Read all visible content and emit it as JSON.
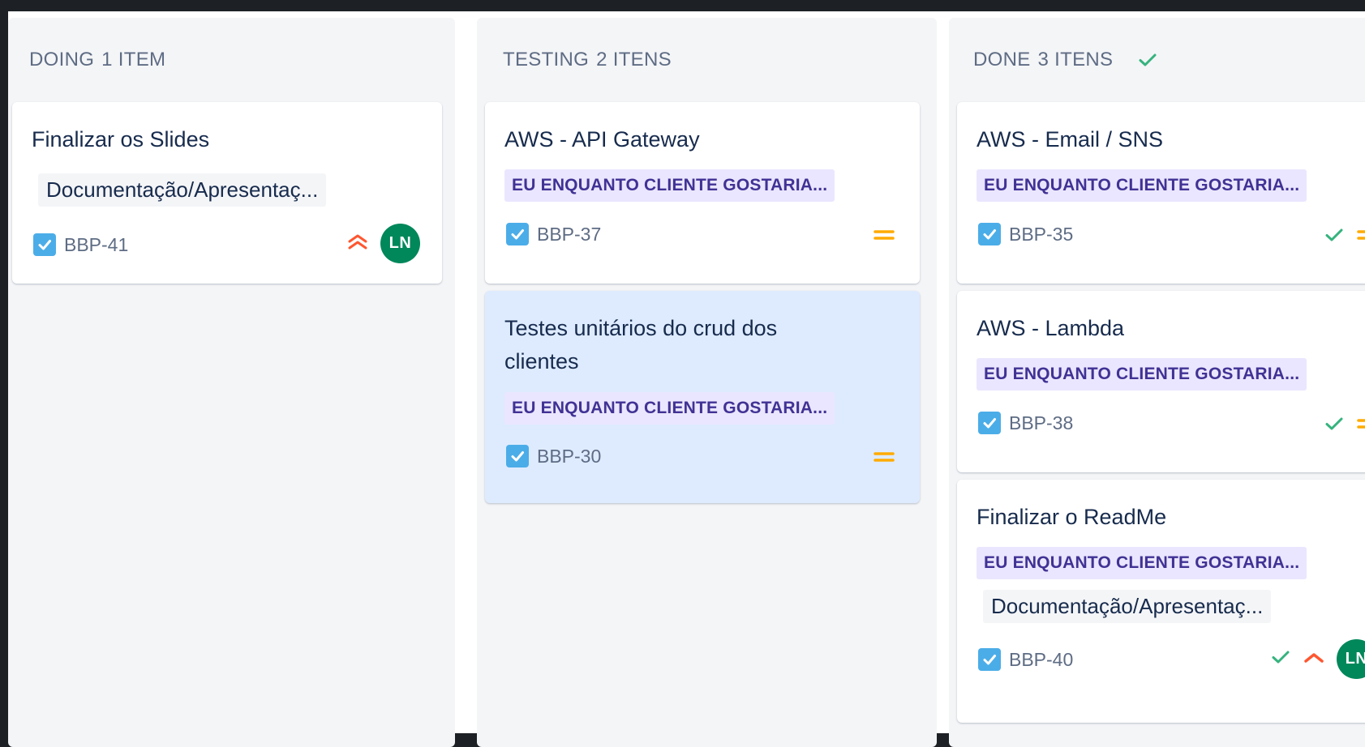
{
  "colors": {
    "column_bg": "#f4f5f7",
    "card_bg": "#ffffff",
    "card_highlight": "#deebff",
    "epic_bg": "#eae6ff",
    "epic_text": "#403294",
    "task_icon": "#4bade8",
    "priority_high": "#ff5630",
    "priority_medium": "#ffab00",
    "done_check": "#36b37e",
    "avatar_bg": "#00875a"
  },
  "columns": [
    {
      "title": "DOING",
      "count": "1 ITEM",
      "cards": [
        {
          "title": "Finalizar os Slides",
          "label": "Documentação/Apresentaç...",
          "key": "BBP-41",
          "priority_icon": "priority-highest-icon",
          "avatar": "LN"
        }
      ]
    },
    {
      "title": "TESTING",
      "count": "2 ITENS",
      "cards": [
        {
          "title": "AWS - API Gateway",
          "epic": "EU ENQUANTO CLIENTE GOSTARIA...",
          "key": "BBP-37",
          "priority_icon": "priority-medium-icon"
        },
        {
          "title": "Testes unitários do crud dos clientes",
          "epic": "EU ENQUANTO CLIENTE GOSTARIA...",
          "key": "BBP-30",
          "priority_icon": "priority-medium-icon"
        }
      ]
    },
    {
      "title": "DONE",
      "count": "3 ITENS",
      "cards": [
        {
          "title": "AWS - Email / SNS",
          "epic": "EU ENQUANTO CLIENTE GOSTARIA...",
          "key": "BBP-35",
          "priority_icon": "priority-medium-icon"
        },
        {
          "title": "AWS - Lambda",
          "epic": "EU ENQUANTO CLIENTE GOSTARIA...",
          "key": "BBP-38",
          "priority_icon": "priority-medium-icon"
        },
        {
          "title": "Finalizar o ReadMe",
          "epic": "EU ENQUANTO CLIENTE GOSTARIA...",
          "label": "Documentação/Apresentaç...",
          "key": "BBP-40",
          "priority_icon": "priority-high-icon",
          "avatar": "LN"
        }
      ]
    }
  ]
}
